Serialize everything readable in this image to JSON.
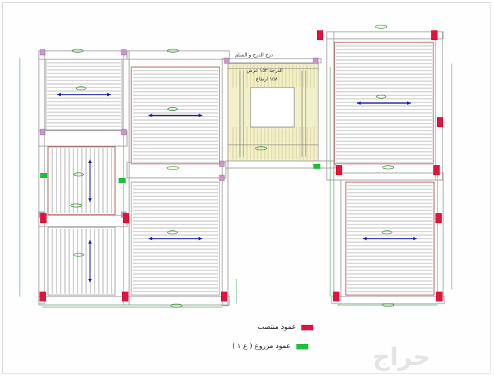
{
  "colors": {
    "wall": "#9a9a9a",
    "joist": "#6e6e6e",
    "rib_red": "#b04a4a",
    "beam_magenta": "#c69ac6",
    "column_red": "#e0143c",
    "column_green": "#1fbf3c",
    "tag_green": "#2e8b2e",
    "arrow_blue": "#1a1aa8",
    "stair_fill": "#f2f0c8",
    "dim_line": "#32a04a"
  },
  "stair": {
    "label_top": "درج الدرج و السلم",
    "label_2": "الدرجة ١٥٢ عرض",
    "label_3": "١٥٨ ارتفاع"
  },
  "legend": {
    "items": [
      {
        "label": "عمود منتصب",
        "color": "#e0143c"
      },
      {
        "label": "عمود مزروع ( ع ١ )",
        "color": "#1fbf3c"
      }
    ]
  },
  "watermark": {
    "text": "حراج"
  }
}
